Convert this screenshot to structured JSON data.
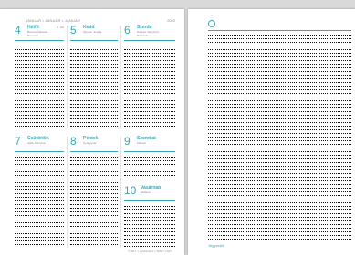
{
  "header": {
    "months": "JANUÁR • JANUÁR • JANUÁR",
    "year": "2022"
  },
  "days_top": [
    {
      "num": "4",
      "name": "Hétfő",
      "sub": "Bertold, Marietta, Benedek",
      "wk": "1. hét"
    },
    {
      "num": "5",
      "name": "Kedd",
      "sub": "Simeon, Emília",
      "wk": ""
    },
    {
      "num": "6",
      "name": "Szerda",
      "sub": "Gáspár, Menyhért, Boldizsár",
      "wk": ""
    }
  ],
  "days_bottom": [
    {
      "num": "7",
      "name": "Csütörtök",
      "sub": "Attila, Ramóna",
      "wk": ""
    },
    {
      "num": "8",
      "name": "Péntek",
      "sub": "Gyöngyvér",
      "wk": ""
    },
    {
      "num": "9",
      "name": "Szombat",
      "sub": "Marcell",
      "wk": ""
    },
    {
      "num": "10",
      "name": "Vasárnap",
      "sub": "Melánia",
      "wk": ""
    }
  ],
  "mini": {
    "num1": "7",
    "name1": "Csütörtök",
    "num2": "8"
  },
  "footer_left": "© MTT KIADÁS • NAPTÁR",
  "footer_right": "Jegyzetek",
  "colors": {
    "accent": "#3aa7b5"
  }
}
